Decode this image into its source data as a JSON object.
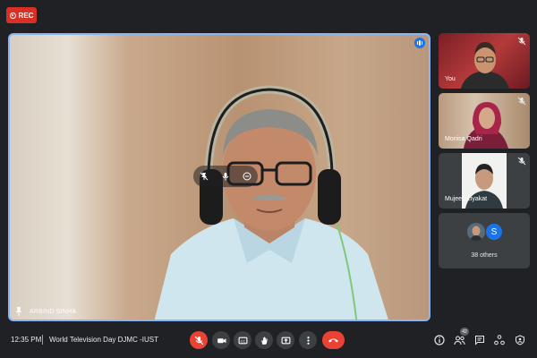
{
  "recording": {
    "label": "REC"
  },
  "main_speaker": {
    "name": "ARBIND SINHA"
  },
  "participants": [
    {
      "name": "You"
    },
    {
      "name": "Monisa Qadri"
    },
    {
      "name": "Mujeeb Liyakat"
    }
  ],
  "others": {
    "avatar_letter": "S",
    "label": "38 others"
  },
  "bottom_bar": {
    "time": "12:35 PM",
    "separator": "|",
    "meeting_title": "World Television Day DJMC -IUST",
    "people_count": "42"
  },
  "colors": {
    "background": "#202124",
    "accent_blue": "#8ab4f8",
    "record_red": "#d93025",
    "mute_red": "#ea4335",
    "button_gray": "#3c4043"
  },
  "icons": [
    "record-icon",
    "mic-off-icon",
    "videocam-icon",
    "closed-caption-icon",
    "raise-hand-icon",
    "present-screen-icon",
    "more-options-icon",
    "end-call-icon",
    "info-icon",
    "people-icon",
    "chat-icon",
    "activities-icon",
    "host-controls-icon",
    "pin-icon",
    "audio-level-icon"
  ]
}
